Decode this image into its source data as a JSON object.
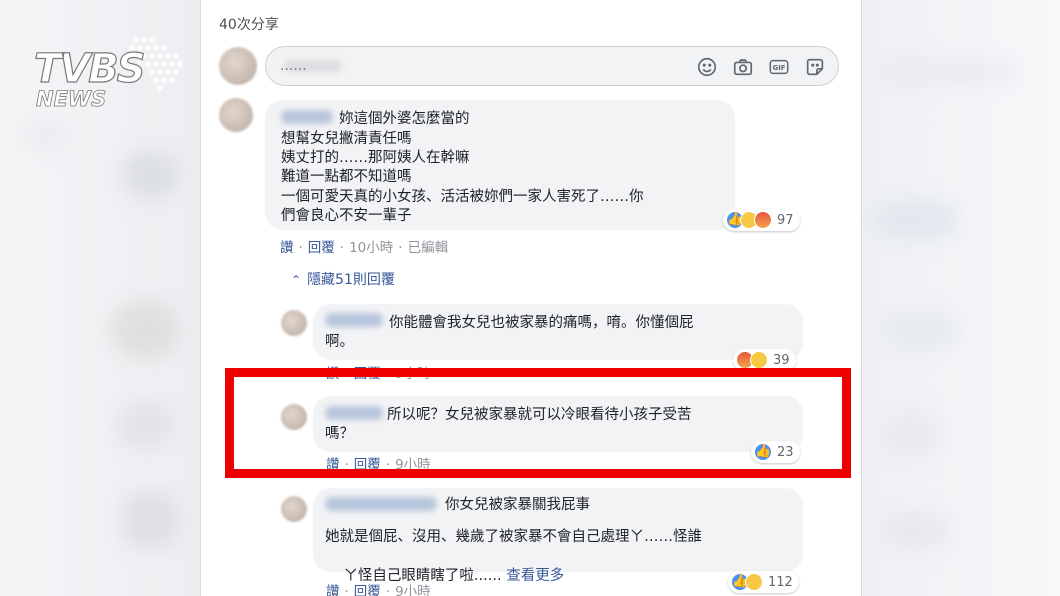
{
  "share_count_label": "40次分享",
  "composer": {
    "placeholder": "......"
  },
  "logo": {
    "line1": "TVBS",
    "line2": "NEWS"
  },
  "comments": [
    {
      "lines": [
        "妳這個外婆怎麼當的",
        "想幫女兒撇清責任嗎",
        "姨丈打的……那阿姨人在幹嘛",
        "難道一點都不知道嗎",
        "一個可愛天真的小女孩、活活被妳們一家人害死了……你",
        "們會良心不安一輩子"
      ],
      "actions": {
        "like": "讚",
        "reply": "回覆",
        "time": "10小時",
        "edited": "已編輯"
      },
      "reactions": {
        "types": [
          "like",
          "sad",
          "angry"
        ],
        "count": "97"
      }
    }
  ],
  "hide_replies_label": "隱藏51則回覆",
  "replies": [
    {
      "lines": [
        "你能體會我女兒也被家暴的痛嗎，唷。你懂個屁",
        "啊。"
      ],
      "actions": {
        "like": "讚",
        "reply": "回覆",
        "time": "9小時"
      },
      "reactions": {
        "types": [
          "angry",
          "haha"
        ],
        "count": "39"
      }
    },
    {
      "lines": [
        "所以呢？女兒被家暴就可以冷眼看待小孩子受苦",
        "嗎？"
      ],
      "actions": {
        "like": "讚",
        "reply": "回覆",
        "time": "9小時"
      },
      "reactions": {
        "types": [
          "like"
        ],
        "count": "23"
      }
    },
    {
      "first_line": "你女兒被家暴關我屁事",
      "lines": [
        "她就是個屁、沒用、幾歲了被家暴不會自己處理ㄚ……怪誰",
        "ㄚ怪自己眼睛瞎了啦......"
      ],
      "see_more": "查看更多",
      "actions": {
        "like": "讚",
        "reply": "回覆",
        "time": "9小時"
      },
      "reactions": {
        "types": [
          "like",
          "haha"
        ],
        "count": "112"
      }
    }
  ],
  "colors": {
    "highlight": "#ee0000",
    "link": "#385898",
    "bubble": "#f2f3f5"
  }
}
